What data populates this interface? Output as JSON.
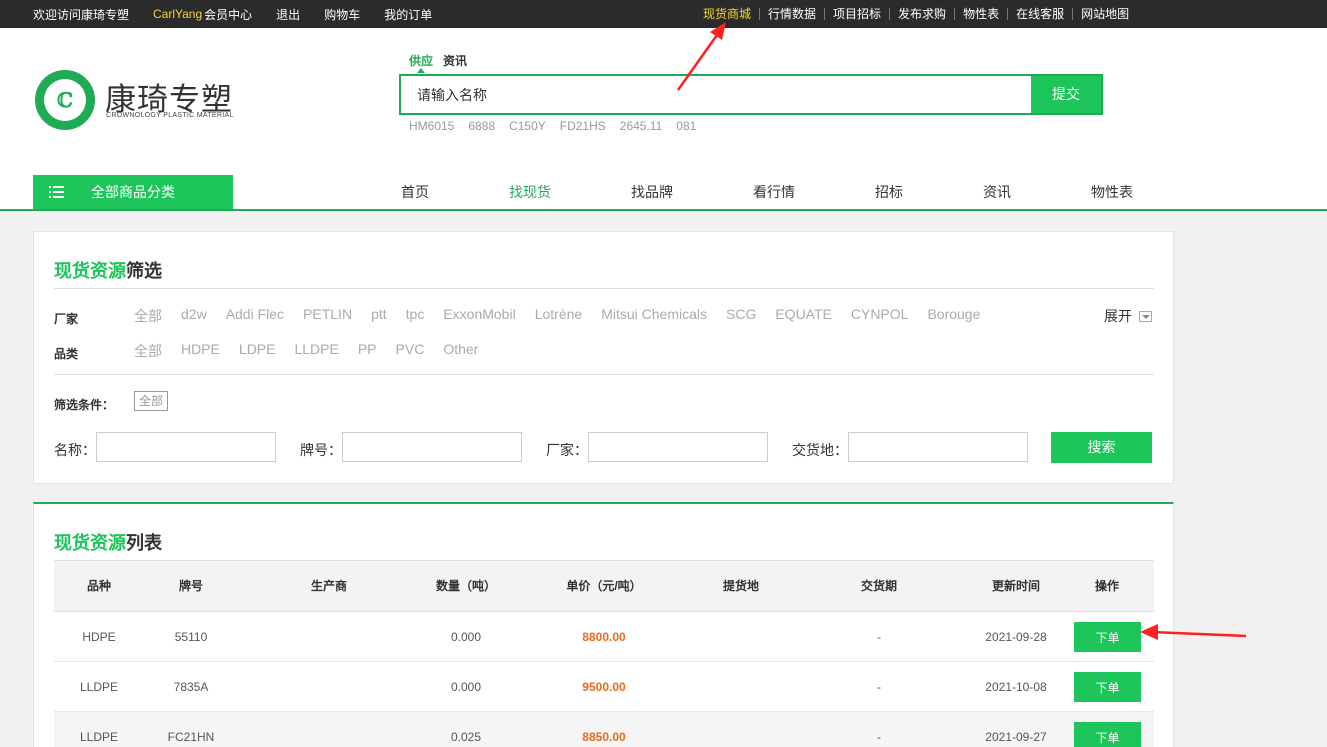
{
  "topbar": {
    "welcome": "欢迎访问康琦专塑",
    "username": "CarlYang",
    "member_center": "会员中心",
    "logout": "退出",
    "cart": "购物车",
    "orders": "我的订单",
    "links": [
      "现货商城",
      "行情数据",
      "项目招标",
      "发布求购",
      "物性表",
      "在线客服",
      "网站地图"
    ]
  },
  "logo": {
    "title": "康琦专塑",
    "subtitle": "CROWNOLOGY PLASTIC MATERIAL"
  },
  "search": {
    "tabs": [
      "供应",
      "资讯"
    ],
    "placeholder": "请输入名称",
    "submit": "提交",
    "hot_words": [
      "HM6015",
      "6888",
      "C150Y",
      "FD21HS",
      "2645.11",
      "081"
    ]
  },
  "nav": {
    "all_categories": "全部商品分类",
    "items": [
      "首页",
      "找现货",
      "找品牌",
      "看行情",
      "招标",
      "资讯",
      "物性表"
    ]
  },
  "filter": {
    "title_green": "现货资源",
    "title_rest": "筛选",
    "maker_label": "厂家",
    "makers": [
      "全部",
      "d2w",
      "Addi Flec",
      "PETLIN",
      "ptt",
      "tpc",
      "ExxonMobil",
      "Lotrène",
      "Mitsui Chemicals",
      "SCG",
      "EQUATE",
      "CYNPOL",
      "Borouge"
    ],
    "expand": "展开",
    "category_label": "品类",
    "categories": [
      "全部",
      "HDPE",
      "LDPE",
      "LLDPE",
      "PP",
      "PVC",
      "Other"
    ],
    "condition_label": "筛选条件：",
    "condition_tag": "全部",
    "name_label": "名称：",
    "grade_label": "牌号：",
    "maker_field_label": "厂家：",
    "delivery_label": "交货地：",
    "search_button": "搜索"
  },
  "list": {
    "title_green": "现货资源",
    "title_rest": "列表",
    "columns": [
      "品种",
      "牌号",
      "生产商",
      "数量（吨）",
      "单价（元/吨）",
      "提货地",
      "交货期",
      "更新时间",
      "操作"
    ],
    "rows": [
      {
        "variety": "HDPE",
        "grade": "55110",
        "maker": "",
        "qty": "0.000",
        "price": "8800.00",
        "pickup": "",
        "delivery": "-",
        "updated": "2021-09-28",
        "action": "下单"
      },
      {
        "variety": "LLDPE",
        "grade": "7835A",
        "maker": "",
        "qty": "0.000",
        "price": "9500.00",
        "pickup": "",
        "delivery": "-",
        "updated": "2021-10-08",
        "action": "下单"
      },
      {
        "variety": "LLDPE",
        "grade": "FC21HN",
        "maker": "",
        "qty": "0.025",
        "price": "8850.00",
        "pickup": "",
        "delivery": "-",
        "updated": "2021-09-27",
        "action": "下单"
      }
    ]
  },
  "colors": {
    "brand_green": "#1ec55b",
    "topbar_bg": "#2b2b2b",
    "highlight_yellow": "#f5d33a",
    "price_orange": "#ee6a1c",
    "annotation_red": "#ff2020"
  }
}
